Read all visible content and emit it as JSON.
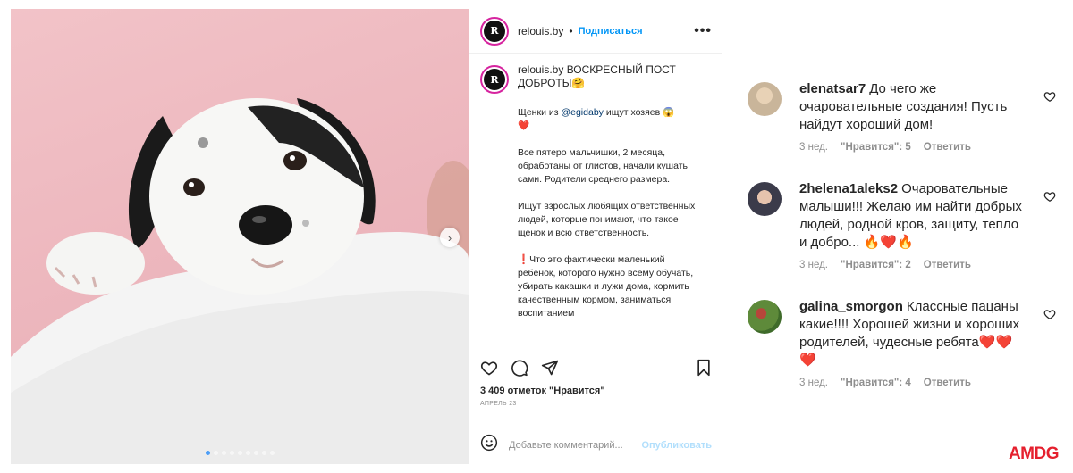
{
  "post": {
    "username": "relouis.by",
    "follow_label": "Подписаться",
    "dot": "•",
    "more": "•••",
    "logo_letter": "R",
    "caption_title": "ВОСКРЕСНЫЙ ПОСТ ДОБРОТЫ🤗",
    "caption_p1_pre": "Щенки из ",
    "caption_p1_link": "@egidaby",
    "caption_p1_post": " ищут хозяев 😱",
    "caption_p1_heart": "❤️",
    "caption_p2": "Все пятеро мальчишки, 2 месяца, обработаны от глистов, начали кушать сами. Родители среднего размера.",
    "caption_p3": "Ищут взрослых любящих ответственных людей, которые понимают, что такое щенок и всю ответственность.",
    "caption_p4": "❗Что это фактически маленький ребенок, которого нужно всему обучать, убирать какашки и лужи дома, кормить качественным кормом, заниматься воспитанием",
    "likes": "3 409 отметок \"Нравится\"",
    "date": "АПРЕЛЬ 23",
    "comment_placeholder": "Добавьте комментарий...",
    "publish_label": "Опубликовать",
    "carousel_dots": 9,
    "carousel_active": 0,
    "next_arrow": "›"
  },
  "comments": [
    {
      "username": "elenatsar7",
      "text": "До чего же очаровательные создания! Пусть найдут хороший дом!",
      "age": "3 нед.",
      "likes": "\"Нравится\": 5",
      "reply": "Ответить",
      "avatar_color": "#c9b59a"
    },
    {
      "username": "2helena1aleks2",
      "text": "Очаровательные малыши!!! Желаю им найти добрых людей, родной кров, защиту, тепло и добро... 🔥❤️🔥",
      "age": "3 нед.",
      "likes": "\"Нравится\": 2",
      "reply": "Ответить",
      "avatar_color": "#6b6f86"
    },
    {
      "username": "galina_smorgon",
      "text": "Классные пацаны какие!!!! Хорошей жизни и хороших родителей, чудесные ребята❤️❤️❤️",
      "age": "3 нед.",
      "likes": "\"Нравится\": 4",
      "reply": "Ответить",
      "avatar_color": "#5e8a3a"
    }
  ],
  "watermark": "AMDG",
  "colors": {
    "accent": "#0095f6",
    "watermark": "#e5202e"
  }
}
